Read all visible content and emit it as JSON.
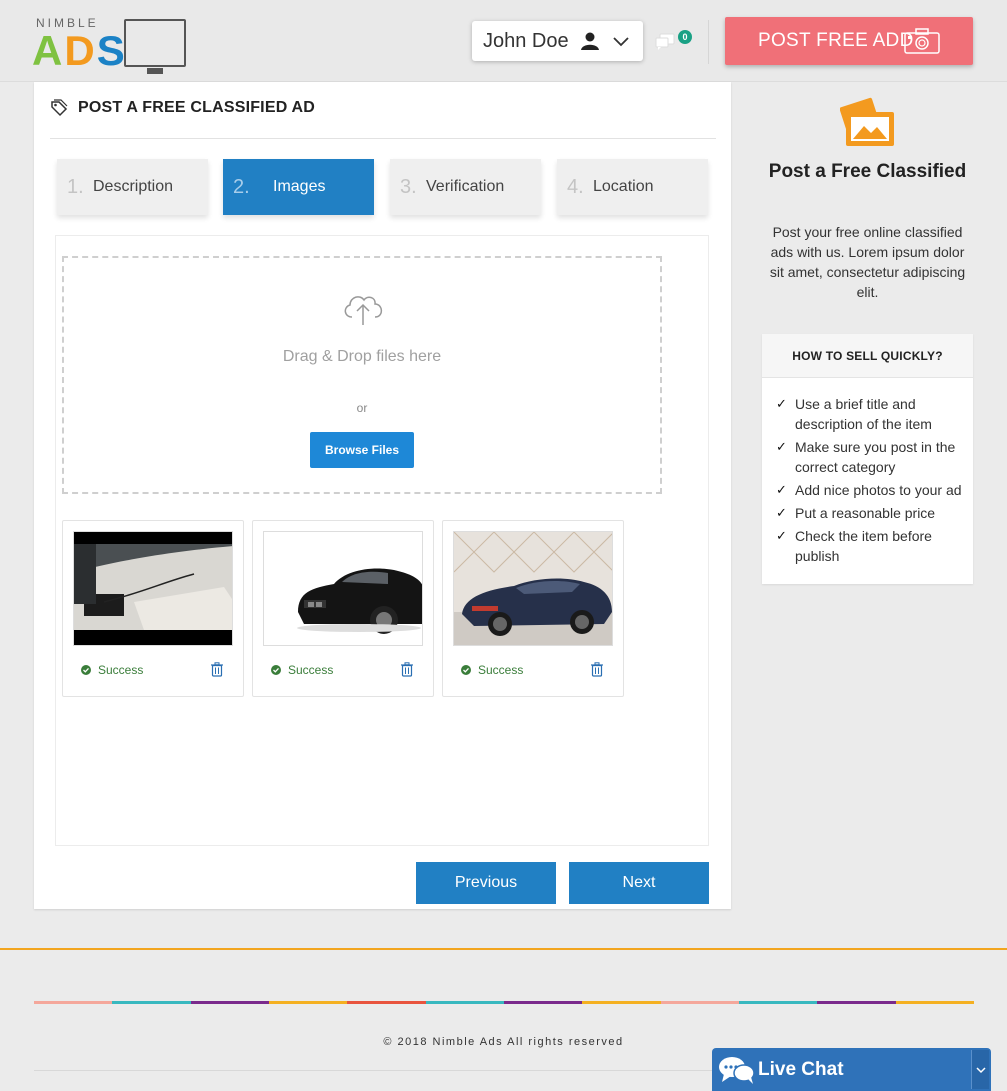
{
  "header": {
    "logo_small": "NIMBLE",
    "logo_big": [
      "A",
      "D",
      "S"
    ],
    "user_name": "John Doe",
    "messages_count": "0",
    "post_button_label": "POST FREE ADD"
  },
  "form": {
    "title": "POST A FREE CLASSIFIED AD",
    "steps": [
      {
        "num": "1.",
        "label": "Description"
      },
      {
        "num": "2.",
        "label": "Images"
      },
      {
        "num": "3.",
        "label": "Verification"
      },
      {
        "num": "4.",
        "label": "Location"
      }
    ],
    "active_step": 2,
    "dropzone": {
      "text": "Drag & Drop files here",
      "or": "or",
      "browse_label": "Browse Files"
    },
    "uploads": [
      {
        "status": "Success"
      },
      {
        "status": "Success"
      },
      {
        "status": "Success"
      }
    ],
    "prev_label": "Previous",
    "next_label": "Next"
  },
  "sidebar": {
    "promo_title": "Post a Free Classified",
    "promo_text": "Post your free online classified ads with us. Lorem ipsum dolor sit amet, consectetur adipiscing elit.",
    "tips_title": "HOW TO SELL QUICKLY?",
    "tips": [
      "Use a brief title and description of the item",
      "Make sure you post in the correct category",
      "Add nice photos to your ad",
      "Put a reasonable price",
      "Check the item before publish"
    ]
  },
  "footer": {
    "copyright": "© 2018 Nimble Ads All rights reserved",
    "stripe_colors": [
      "#f4a79b",
      "#38b8bf",
      "#7a2a8c",
      "#f4b021",
      "#e8543e",
      "#38b8bf",
      "#7a2a8c",
      "#f4b021",
      "#f4a79b",
      "#38b8bf",
      "#7a2a8c",
      "#f4b021"
    ]
  },
  "livechat": {
    "label": "Live Chat"
  },
  "colors": {
    "accent_blue": "#2180c4",
    "post_button": "#f07078",
    "success": "#3a7d3a",
    "promo_orange": "#f39a1f"
  }
}
